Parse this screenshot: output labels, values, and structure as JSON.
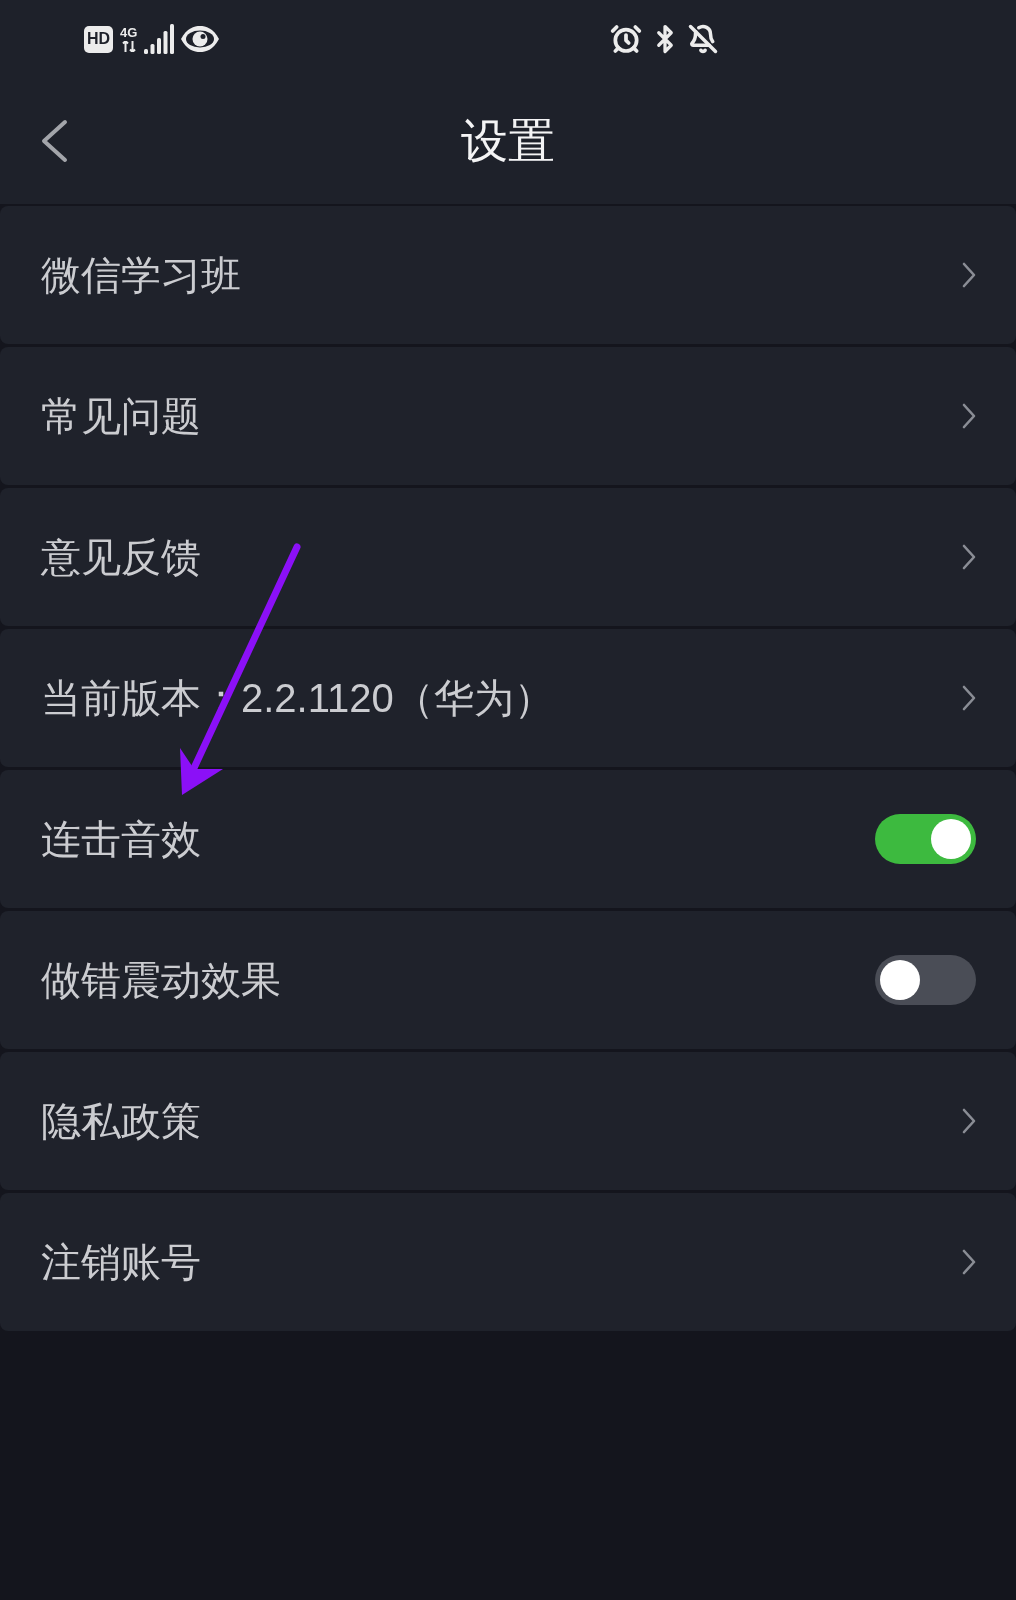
{
  "status_bar": {
    "hd_badge": "HD",
    "network_type": "4G"
  },
  "header": {
    "title": "设置"
  },
  "settings": [
    {
      "kind": "link",
      "label": "微信学习班"
    },
    {
      "kind": "link",
      "label": "常见问题"
    },
    {
      "kind": "link",
      "label": "意见反馈"
    },
    {
      "kind": "link",
      "label": "当前版本：2.2.1120（华为）"
    },
    {
      "kind": "toggle",
      "label": "连击音效",
      "on": true
    },
    {
      "kind": "toggle",
      "label": "做错震动效果",
      "on": false
    },
    {
      "kind": "link",
      "label": "隐私政策"
    },
    {
      "kind": "link",
      "label": "注销账号"
    }
  ]
}
